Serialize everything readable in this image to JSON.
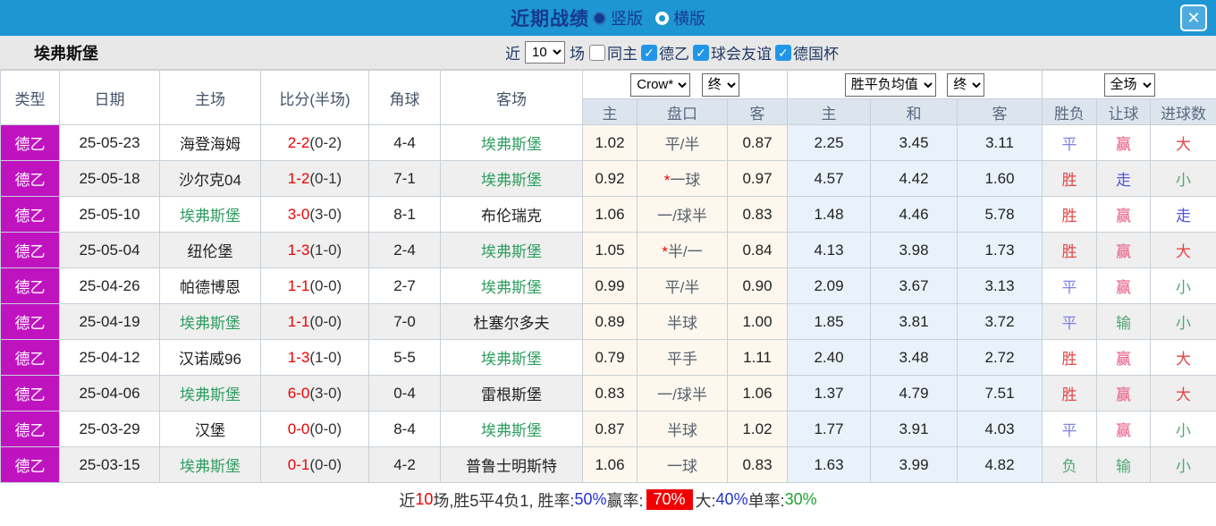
{
  "titlebar": {
    "title": "近期战绩",
    "radios": [
      {
        "label": "竖版",
        "selected": true
      },
      {
        "label": "横版",
        "selected": false
      }
    ],
    "close_label": "✕"
  },
  "filterbar": {
    "team": "埃弗斯堡",
    "recent_label": "近",
    "recent_value": "10",
    "games_label": "场",
    "checks": [
      {
        "label": "同主",
        "checked": false
      },
      {
        "label": "德乙",
        "checked": true
      },
      {
        "label": "球会友谊",
        "checked": true
      },
      {
        "label": "德国杯",
        "checked": true
      }
    ]
  },
  "header": {
    "left_columns": [
      "类型",
      "日期",
      "主场",
      "比分(半场)",
      "角球",
      "客场"
    ],
    "odds_group": {
      "select1": "Crow*",
      "select2": "终",
      "cols": [
        "主",
        "盘口",
        "客"
      ]
    },
    "avg_group": {
      "select1": "胜平负均值",
      "select2": "终",
      "cols": [
        "主",
        "和",
        "客"
      ]
    },
    "result_group": {
      "select": "全场",
      "cols": [
        "胜负",
        "让球",
        "进球数"
      ]
    }
  },
  "colors": {
    "bar_blue": "#1e96d3",
    "type_magenta": "#c013c0",
    "team_green": "#2f9e60",
    "score_red": "#f00000",
    "win_red": "#e64545",
    "handicap_pink": "#e8527e",
    "draw_blue": "#8080e8",
    "push_blue": "#5353dd",
    "lose_green": "#52a473"
  },
  "rows": [
    {
      "type": "德乙",
      "date": "25-05-23",
      "home": "海登海姆",
      "home_team": false,
      "score": "2-2",
      "half": "(0-2)",
      "corners": "4-4",
      "away": "埃弗斯堡",
      "away_team": true,
      "odds_home": "1.02",
      "star": false,
      "handicap": "平/半",
      "odds_away": "0.87",
      "avg_home": "2.25",
      "avg_draw": "3.45",
      "avg_away": "3.11",
      "result": "平",
      "result_c": "blue",
      "rh": "赢",
      "rh_c": "pink",
      "goals": "大",
      "goals_c": "red"
    },
    {
      "type": "德乙",
      "date": "25-05-18",
      "home": "沙尔克04",
      "home_team": false,
      "score": "1-2",
      "half": "(0-1)",
      "corners": "7-1",
      "away": "埃弗斯堡",
      "away_team": true,
      "odds_home": "0.92",
      "star": true,
      "handicap": "一球",
      "odds_away": "0.97",
      "avg_home": "4.57",
      "avg_draw": "4.42",
      "avg_away": "1.60",
      "result": "胜",
      "result_c": "red",
      "rh": "走",
      "rh_c": "blue2",
      "goals": "小",
      "goals_c": "green"
    },
    {
      "type": "德乙",
      "date": "25-05-10",
      "home": "埃弗斯堡",
      "home_team": true,
      "score": "3-0",
      "half": "(3-0)",
      "corners": "8-1",
      "away": "布伦瑞克",
      "away_team": false,
      "odds_home": "1.06",
      "star": false,
      "handicap": "一/球半",
      "odds_away": "0.83",
      "avg_home": "1.48",
      "avg_draw": "4.46",
      "avg_away": "5.78",
      "result": "胜",
      "result_c": "red",
      "rh": "赢",
      "rh_c": "pink",
      "goals": "走",
      "goals_c": "blue2"
    },
    {
      "type": "德乙",
      "date": "25-05-04",
      "home": "纽伦堡",
      "home_team": false,
      "score": "1-3",
      "half": "(1-0)",
      "corners": "2-4",
      "away": "埃弗斯堡",
      "away_team": true,
      "odds_home": "1.05",
      "star": true,
      "handicap": "半/一",
      "odds_away": "0.84",
      "avg_home": "4.13",
      "avg_draw": "3.98",
      "avg_away": "1.73",
      "result": "胜",
      "result_c": "red",
      "rh": "赢",
      "rh_c": "pink",
      "goals": "大",
      "goals_c": "red"
    },
    {
      "type": "德乙",
      "date": "25-04-26",
      "home": "帕德博恩",
      "home_team": false,
      "score": "1-1",
      "half": "(0-0)",
      "corners": "2-7",
      "away": "埃弗斯堡",
      "away_team": true,
      "odds_home": "0.99",
      "star": false,
      "handicap": "平/半",
      "odds_away": "0.90",
      "avg_home": "2.09",
      "avg_draw": "3.67",
      "avg_away": "3.13",
      "result": "平",
      "result_c": "blue",
      "rh": "赢",
      "rh_c": "pink",
      "goals": "小",
      "goals_c": "green"
    },
    {
      "type": "德乙",
      "date": "25-04-19",
      "home": "埃弗斯堡",
      "home_team": true,
      "score": "1-1",
      "half": "(0-0)",
      "corners": "7-0",
      "away": "杜塞尔多夫",
      "away_team": false,
      "odds_home": "0.89",
      "star": false,
      "handicap": "半球",
      "odds_away": "1.00",
      "avg_home": "1.85",
      "avg_draw": "3.81",
      "avg_away": "3.72",
      "result": "平",
      "result_c": "blue",
      "rh": "输",
      "rh_c": "green",
      "goals": "小",
      "goals_c": "green"
    },
    {
      "type": "德乙",
      "date": "25-04-12",
      "home": "汉诺威96",
      "home_team": false,
      "score": "1-3",
      "half": "(1-0)",
      "corners": "5-5",
      "away": "埃弗斯堡",
      "away_team": true,
      "odds_home": "0.79",
      "star": false,
      "handicap": "平手",
      "odds_away": "1.11",
      "avg_home": "2.40",
      "avg_draw": "3.48",
      "avg_away": "2.72",
      "result": "胜",
      "result_c": "red",
      "rh": "赢",
      "rh_c": "pink",
      "goals": "大",
      "goals_c": "red"
    },
    {
      "type": "德乙",
      "date": "25-04-06",
      "home": "埃弗斯堡",
      "home_team": true,
      "score": "6-0",
      "half": "(3-0)",
      "corners": "0-4",
      "away": "雷根斯堡",
      "away_team": false,
      "odds_home": "0.83",
      "star": false,
      "handicap": "一/球半",
      "odds_away": "1.06",
      "avg_home": "1.37",
      "avg_draw": "4.79",
      "avg_away": "7.51",
      "result": "胜",
      "result_c": "red",
      "rh": "赢",
      "rh_c": "pink",
      "goals": "大",
      "goals_c": "red"
    },
    {
      "type": "德乙",
      "date": "25-03-29",
      "home": "汉堡",
      "home_team": false,
      "score": "0-0",
      "half": "(0-0)",
      "corners": "8-4",
      "away": "埃弗斯堡",
      "away_team": true,
      "odds_home": "0.87",
      "star": false,
      "handicap": "半球",
      "odds_away": "1.02",
      "avg_home": "1.77",
      "avg_draw": "3.91",
      "avg_away": "4.03",
      "result": "平",
      "result_c": "blue",
      "rh": "赢",
      "rh_c": "pink",
      "goals": "小",
      "goals_c": "green"
    },
    {
      "type": "德乙",
      "date": "25-03-15",
      "home": "埃弗斯堡",
      "home_team": true,
      "score": "0-1",
      "half": "(0-0)",
      "corners": "4-2",
      "away": "普鲁士明斯特",
      "away_team": false,
      "odds_home": "1.06",
      "star": false,
      "handicap": "一球",
      "odds_away": "0.83",
      "avg_home": "1.63",
      "avg_draw": "3.99",
      "avg_away": "4.82",
      "result": "负",
      "result_c": "green",
      "rh": "输",
      "rh_c": "green",
      "goals": "小",
      "goals_c": "green"
    }
  ],
  "summary": {
    "segments": [
      {
        "text": "近",
        "style": "plain"
      },
      {
        "text": "10",
        "style": "red"
      },
      {
        "text": "场,胜5平4负1, 胜率:",
        "style": "plain"
      },
      {
        "text": "50%",
        "style": "blue"
      },
      {
        "text": " 赢率: ",
        "style": "plain"
      },
      {
        "text": "70%",
        "style": "badge"
      },
      {
        "text": " 大:",
        "style": "plain"
      },
      {
        "text": "40%",
        "style": "blue"
      },
      {
        "text": " 单率:",
        "style": "plain"
      },
      {
        "text": "30%",
        "style": "green"
      }
    ]
  }
}
